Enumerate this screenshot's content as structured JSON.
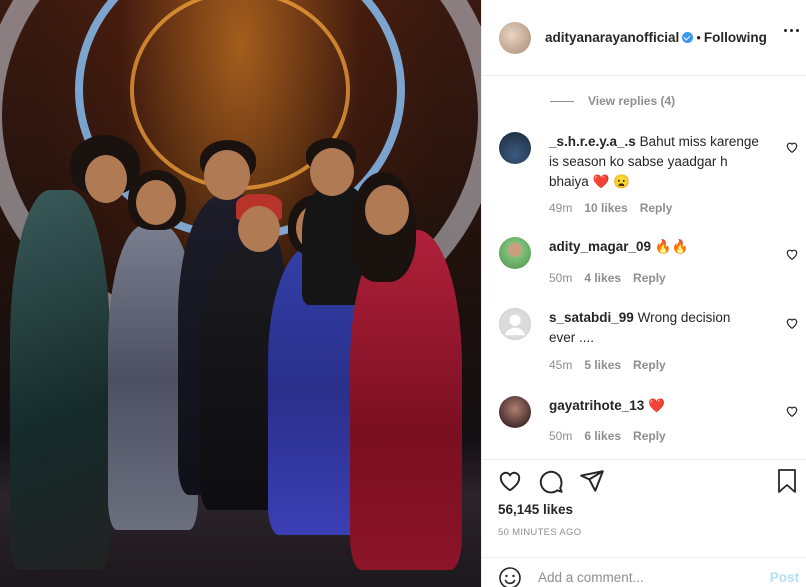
{
  "post": {
    "photo_alt": "group photo",
    "username": "adityanarayanofficial",
    "separator": "•",
    "follow_status": "Following"
  },
  "comments": {
    "view_replies": "View replies (4)",
    "items": [
      {
        "username": "_s.h.r.e.y.a_.s",
        "text": "Bahut miss karenge is season ko sabse yaadgar h bhaiya ❤️ 😦",
        "time": "49m",
        "likes": "10 likes",
        "reply": "Reply",
        "avatar_color": "#1d2a3a"
      },
      {
        "username": "adity_magar_09",
        "text": "🔥🔥",
        "time": "50m",
        "likes": "4 likes",
        "reply": "Reply",
        "avatar_color": "#6fb36a"
      },
      {
        "username": "s_satabdi_99",
        "text": "Wrong decision ever ....",
        "time": "45m",
        "likes": "5 likes",
        "reply": "Reply",
        "avatar_color": "#dbdbdb"
      },
      {
        "username": "gayatrihote_13",
        "text": "❤️",
        "time": "50m",
        "likes": "6 likes",
        "reply": "Reply",
        "avatar_color": "#6a4a4a"
      }
    ]
  },
  "stats": {
    "likes": "56,145 likes",
    "time_ago": "50 MINUTES AGO"
  },
  "add_comment": {
    "placeholder": "Add a comment...",
    "post_label": "Post"
  },
  "icons": {
    "like": "heart-outline-icon",
    "comment": "comment-bubble-icon",
    "share": "paper-plane-icon",
    "save": "bookmark-icon",
    "more": "more-options-icon",
    "emoji": "smiley-icon"
  },
  "colors": {
    "link_blue": "#3897f0",
    "muted": "#8e8e8e",
    "text": "#262626",
    "post_disabled": "#b2dffc"
  }
}
